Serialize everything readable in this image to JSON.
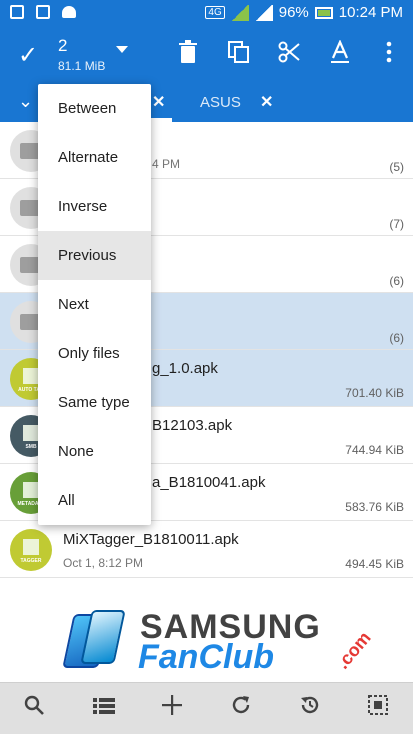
{
  "status_bar": {
    "icons": [
      "wifi-hotspot-icon",
      "gallery-icon",
      "android-icon"
    ],
    "network": "4G",
    "battery": "96%",
    "time": "10:24 PM"
  },
  "action_bar": {
    "selected_count": "2",
    "selected_size": "81.1 MiB",
    "tools": [
      "delete-icon",
      "copy-icon",
      "cut-icon",
      "rename-icon",
      "overflow-icon"
    ]
  },
  "tabs": {
    "items": [
      {
        "label": ""
      },
      {
        "label": "ASUS"
      }
    ]
  },
  "menu": {
    "items": [
      "Between",
      "Alternate",
      "Inverse",
      "Previous",
      "Next",
      "Only files",
      "Same type",
      "None",
      "All"
    ],
    "active_index": 3
  },
  "files": [
    {
      "name": "",
      "date": "4 PM",
      "meta": "(5)",
      "type": "folder",
      "selected": false
    },
    {
      "name": "",
      "date": "",
      "meta": "(7)",
      "type": "folder",
      "selected": false,
      "dot": "#42a5f5"
    },
    {
      "name": "",
      "date": "",
      "meta": "(6)",
      "type": "folder",
      "selected": false,
      "dot": "#e53935"
    },
    {
      "name": "",
      "date": "",
      "meta": "(6)",
      "type": "folder",
      "selected": true,
      "dot": "#e53935"
    },
    {
      "name": "g_1.0.apk",
      "date": "",
      "meta": "701.40 KiB",
      "type": "apk",
      "variant": "apk1",
      "tag": "AUTO TAG",
      "selected": true
    },
    {
      "name": "B12103.apk",
      "date": "",
      "meta": "744.94 KiB",
      "type": "apk",
      "variant": "apk2",
      "tag": "SMB",
      "selected": false
    },
    {
      "name": "a_B1810041.apk",
      "date": "",
      "meta": "583.76 KiB",
      "type": "apk",
      "variant": "apk3",
      "tag": "METADATA",
      "selected": false
    },
    {
      "name": "MiXTagger_B1810011.apk",
      "date": "Oct 1, 8:12 PM",
      "meta": "494.45 KiB",
      "type": "apk",
      "variant": "apk4",
      "tag": "TAGGER",
      "selected": false
    }
  ],
  "watermark": {
    "line1": "SAMSUNG",
    "line2": "FanClub",
    "tld": ".com"
  },
  "bottom_bar": {
    "buttons": [
      "search-icon",
      "list-view-icon",
      "add-icon",
      "refresh-icon",
      "history-icon",
      "select-all-icon"
    ]
  },
  "colors": {
    "primary": "#1976d2",
    "selected_row": "#cfe0f1",
    "bottom_bar": "#e0e0e0"
  }
}
